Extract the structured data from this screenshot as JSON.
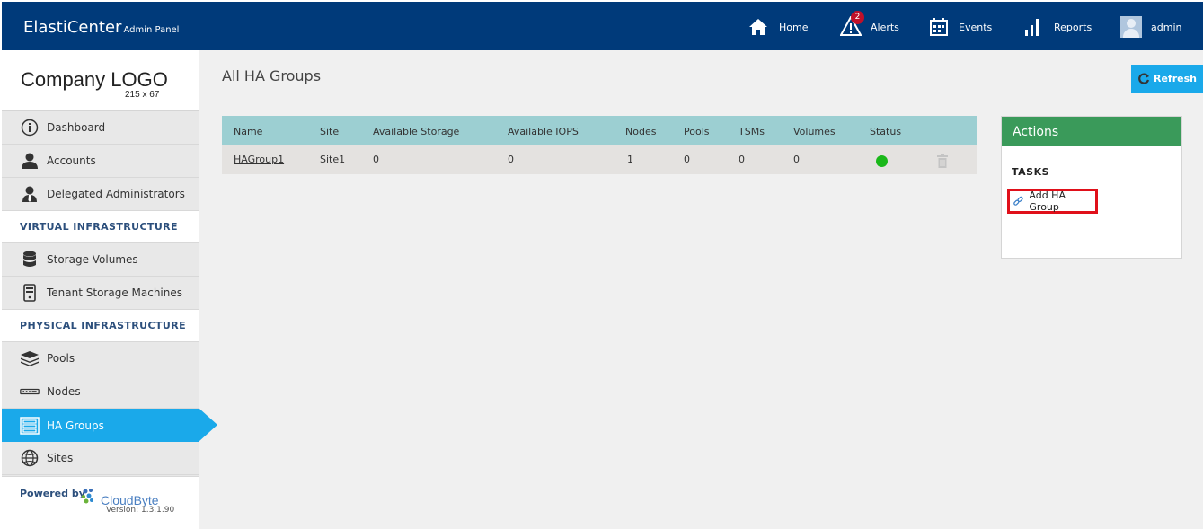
{
  "app": {
    "name": "ElastiCenter",
    "subtitle": "Admin Panel"
  },
  "nav": {
    "home": "Home",
    "alerts": "Alerts",
    "alerts_count": "2",
    "events": "Events",
    "reports": "Reports",
    "user": "admin"
  },
  "sidebar": {
    "logo_title": "Company LOGO",
    "logo_size": "215 x 67",
    "items": [
      {
        "label": "Dashboard",
        "icon": "info-icon"
      },
      {
        "label": "Accounts",
        "icon": "user-icon"
      },
      {
        "label": "Delegated Administrators",
        "icon": "admin-user-icon"
      }
    ],
    "section_virtual": "VIRTUAL INFRASTRUCTURE",
    "virtual_items": [
      {
        "label": "Storage Volumes",
        "icon": "database-icon"
      },
      {
        "label": "Tenant Storage Machines",
        "icon": "server-icon"
      }
    ],
    "section_physical": "PHYSICAL INFRASTRUCTURE",
    "physical_items": [
      {
        "label": "Pools",
        "icon": "layers-icon"
      },
      {
        "label": "Nodes",
        "icon": "node-icon"
      },
      {
        "label": "HA Groups",
        "icon": "rack-icon",
        "active": true
      },
      {
        "label": "Sites",
        "icon": "globe-icon"
      }
    ],
    "powered_by": "Powered by",
    "vendor": "CloudByte",
    "version": "Version: 1.3.1.90"
  },
  "main": {
    "title": "All HA Groups",
    "refresh_label": "Refresh",
    "table": {
      "columns": [
        "Name",
        "Site",
        "Available Storage",
        "Available IOPS",
        "Nodes",
        "Pools",
        "TSMs",
        "Volumes",
        "Status"
      ],
      "rows": [
        {
          "name": "HAGroup1",
          "site": "Site1",
          "storage": "0",
          "iops": "0",
          "nodes": "1",
          "pools": "0",
          "tsms": "0",
          "volumes": "0",
          "status": "online"
        }
      ]
    }
  },
  "actions": {
    "title": "Actions",
    "tasks_label": "TASKS",
    "add_label": "Add HA Group"
  },
  "colors": {
    "topbar": "#003a7a",
    "accent": "#1aa9ea",
    "actions_header": "#3a9a5a",
    "table_header": "#9ccfd2",
    "status_ok": "#1ab81a"
  }
}
